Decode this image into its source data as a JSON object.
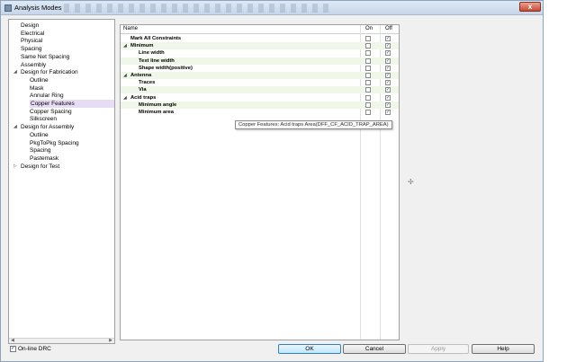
{
  "window": {
    "title": "Analysis Modes",
    "close_label": "x"
  },
  "tree": {
    "items": [
      {
        "label": "Design",
        "level": 1,
        "expander": "",
        "selected": false
      },
      {
        "label": "Electrical",
        "level": 1,
        "expander": "",
        "selected": false
      },
      {
        "label": "Physical",
        "level": 1,
        "expander": "",
        "selected": false
      },
      {
        "label": "Spacing",
        "level": 1,
        "expander": "",
        "selected": false
      },
      {
        "label": "Same Net Spacing",
        "level": 1,
        "expander": "",
        "selected": false
      },
      {
        "label": "Assembly",
        "level": 1,
        "expander": "",
        "selected": false
      },
      {
        "label": "Design for Fabrication",
        "level": 1,
        "expander": "expanded",
        "selected": false
      },
      {
        "label": "Outline",
        "level": 2,
        "expander": "",
        "selected": false
      },
      {
        "label": "Mask",
        "level": 2,
        "expander": "",
        "selected": false
      },
      {
        "label": "Annular Ring",
        "level": 2,
        "expander": "",
        "selected": false
      },
      {
        "label": "Copper Features",
        "level": 2,
        "expander": "",
        "selected": true
      },
      {
        "label": "Copper Spacing",
        "level": 2,
        "expander": "",
        "selected": false
      },
      {
        "label": "Silkscreen",
        "level": 2,
        "expander": "",
        "selected": false
      },
      {
        "label": "Design for Assembly",
        "level": 1,
        "expander": "expanded",
        "selected": false
      },
      {
        "label": "Outline",
        "level": 2,
        "expander": "",
        "selected": false
      },
      {
        "label": "PkgToPkg Spacing",
        "level": 2,
        "expander": "",
        "selected": false
      },
      {
        "label": "Spacing",
        "level": 2,
        "expander": "",
        "selected": false
      },
      {
        "label": "Pastemask",
        "level": 2,
        "expander": "",
        "selected": false
      },
      {
        "label": "Design for Test",
        "level": 1,
        "expander": "collapsed",
        "selected": false
      }
    ]
  },
  "grid": {
    "headers": {
      "name": "Name",
      "on": "On",
      "off": "Off"
    },
    "rows": [
      {
        "name": "Mark All Constraints",
        "level": 1,
        "group": false,
        "on": false,
        "off": true,
        "shaded": false
      },
      {
        "name": "Minimum",
        "level": 1,
        "group": true,
        "on": false,
        "off": true,
        "shaded": true
      },
      {
        "name": "Line width",
        "level": 2,
        "group": false,
        "on": false,
        "off": true,
        "shaded": false
      },
      {
        "name": "Text line width",
        "level": 3,
        "group": false,
        "on": false,
        "off": true,
        "shaded": true
      },
      {
        "name": "Shape width(positive)",
        "level": 3,
        "group": false,
        "on": false,
        "off": true,
        "shaded": false
      },
      {
        "name": "Antenna",
        "level": 1,
        "group": true,
        "on": false,
        "off": true,
        "shaded": true
      },
      {
        "name": "Traces",
        "level": 3,
        "group": false,
        "on": false,
        "off": true,
        "shaded": false
      },
      {
        "name": "Via",
        "level": 3,
        "group": false,
        "on": false,
        "off": true,
        "shaded": true
      },
      {
        "name": "Acid traps",
        "level": 1,
        "group": true,
        "on": false,
        "off": true,
        "shaded": false
      },
      {
        "name": "Minimum angle",
        "level": 3,
        "group": false,
        "on": false,
        "off": true,
        "shaded": true
      },
      {
        "name": "Minimum area",
        "level": 3,
        "group": false,
        "on": false,
        "off": true,
        "shaded": false
      }
    ]
  },
  "tooltip": {
    "text": "Copper Features: Acid traps Area(DFF_CF_ACID_TRAP_AREA)"
  },
  "footer": {
    "online_drc_label": "On-line DRC",
    "online_drc_checked": true,
    "ok_label": "OK",
    "cancel_label": "Cancel",
    "apply_label": "Apply",
    "help_label": "Help"
  },
  "icons": {
    "expanded_glyph": "◢",
    "collapsed_glyph": "▷",
    "check_glyph": "✓",
    "splitter_glyph": "✢"
  }
}
